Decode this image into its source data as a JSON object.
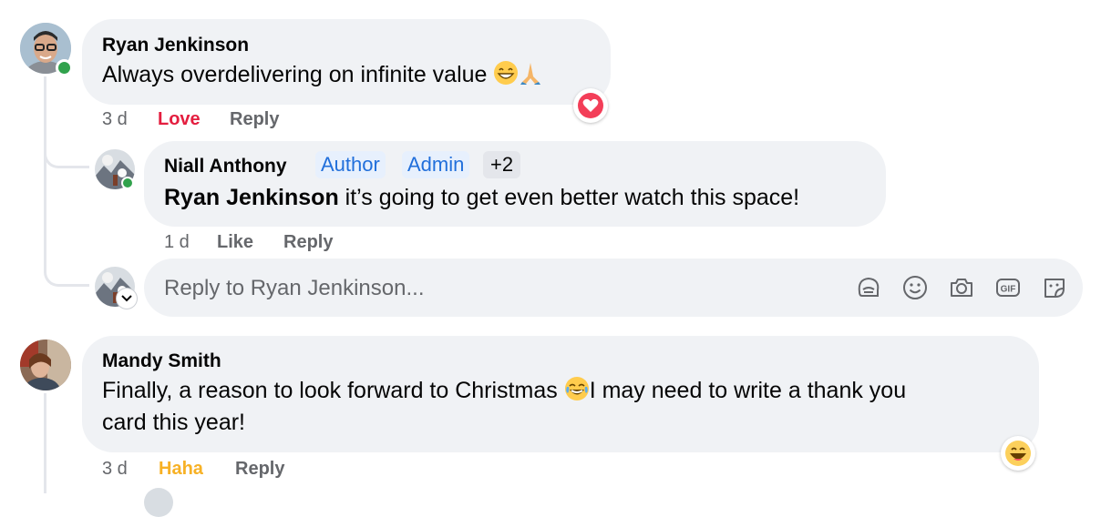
{
  "colors": {
    "love": "#e41e3f",
    "haha": "#f7b125",
    "link": "#216fdb",
    "muted": "#65676b",
    "bubble": "#f0f2f5",
    "online": "#31a24c"
  },
  "comments": [
    {
      "author": "Ryan Jenkinson",
      "text": "Always overdelivering on infinite value",
      "text_emojis": [
        "grinning-face-with-smiling-eyes",
        "folded-hands"
      ],
      "time": "3 d",
      "reaction_label": "Love",
      "reply_label": "Reply",
      "reaction_badge": "heart-reaction",
      "online": true
    },
    {
      "author": "Niall Anthony",
      "tags": [
        "Author",
        "Admin"
      ],
      "extra_count": "+2",
      "mention": "Ryan Jenkinson",
      "text": " it’s going to get even better watch this space!",
      "time": "1 d",
      "like_label": "Like",
      "reply_label": "Reply",
      "online": true
    },
    {
      "author": "Mandy Smith",
      "text_line1_a": "Finally, a reason to look forward to Christmas",
      "text_emoji": "face-with-tears-of-joy",
      "text_line1_b": "I may need to write a thank you",
      "text_line2": "card this year!",
      "time": "3 d",
      "reaction_label": "Haha",
      "reply_label": "Reply",
      "reaction_badge": "haha-reaction"
    }
  ],
  "reply_box": {
    "placeholder": "Reply to Ryan Jenkinson...",
    "tools": [
      "avatar-sticker-icon",
      "emoji-icon",
      "camera-icon",
      "gif-icon",
      "sticker-icon"
    ]
  }
}
